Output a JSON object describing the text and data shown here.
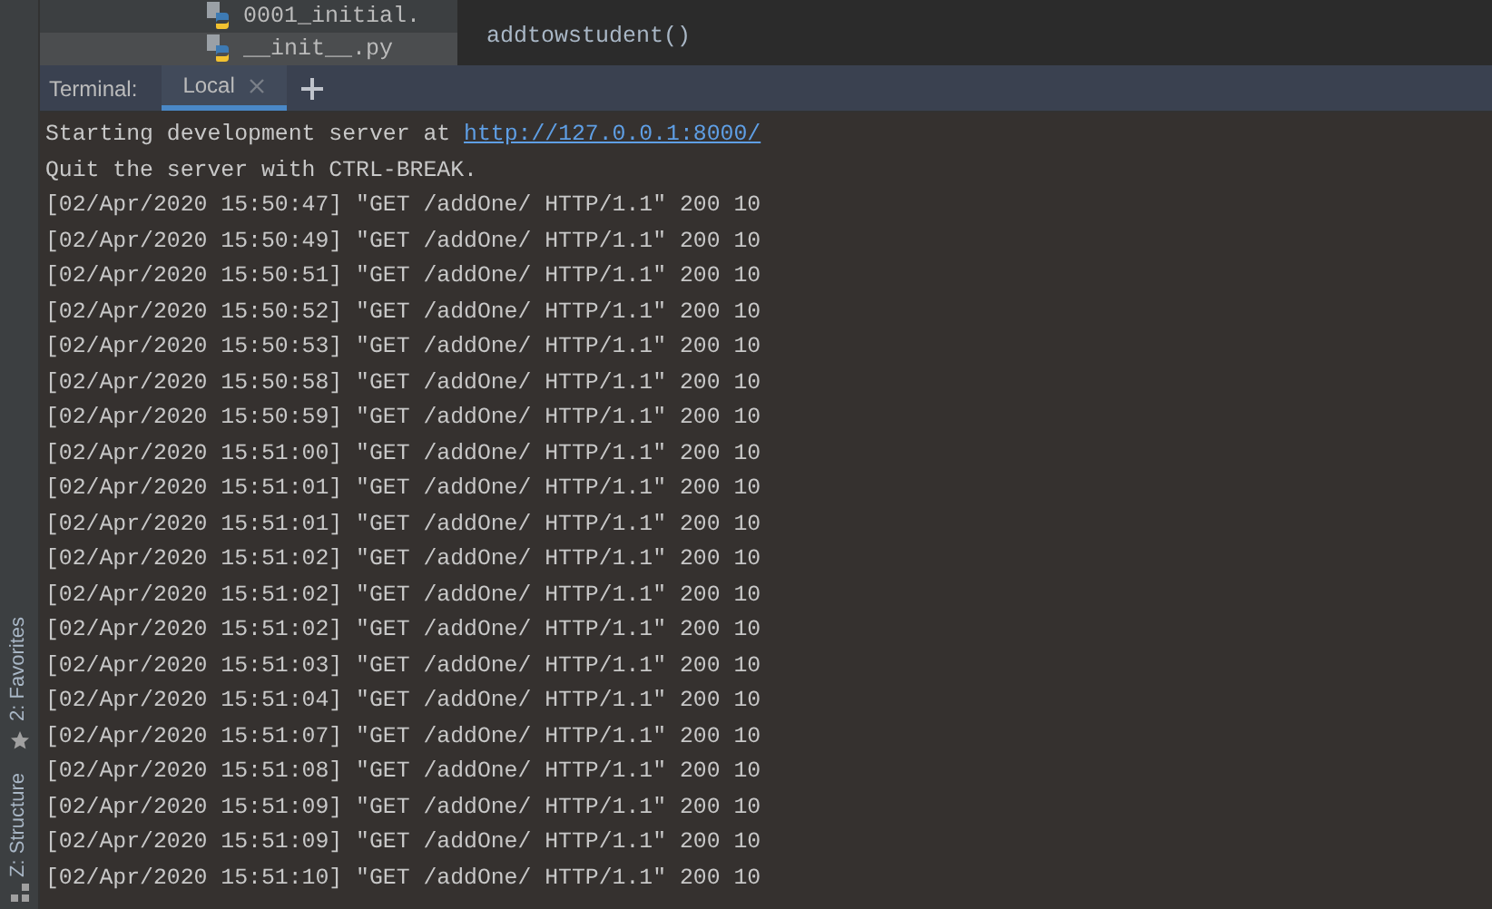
{
  "side_tool_windows": [
    {
      "label": "2: Favorites"
    },
    {
      "label": "Z: Structure"
    }
  ],
  "project_tree": [
    {
      "label": "0001_initial.",
      "selected": false
    },
    {
      "label": "__init__.py",
      "selected": true
    }
  ],
  "editor": {
    "code_line": "addtowstudent()"
  },
  "terminal": {
    "title": "Terminal:",
    "tabs": [
      {
        "label": "Local",
        "selected": true
      }
    ],
    "intro": {
      "text": "Starting development server at",
      "link": "http://127.0.0.1:8000/"
    },
    "lines": [
      "Quit the server with CTRL-BREAK.",
      "[02/Apr/2020 15:50:47] \"GET /addOne/ HTTP/1.1\" 200 10",
      "[02/Apr/2020 15:50:49] \"GET /addOne/ HTTP/1.1\" 200 10",
      "[02/Apr/2020 15:50:51] \"GET /addOne/ HTTP/1.1\" 200 10",
      "[02/Apr/2020 15:50:52] \"GET /addOne/ HTTP/1.1\" 200 10",
      "[02/Apr/2020 15:50:53] \"GET /addOne/ HTTP/1.1\" 200 10",
      "[02/Apr/2020 15:50:58] \"GET /addOne/ HTTP/1.1\" 200 10",
      "[02/Apr/2020 15:50:59] \"GET /addOne/ HTTP/1.1\" 200 10",
      "[02/Apr/2020 15:51:00] \"GET /addOne/ HTTP/1.1\" 200 10",
      "[02/Apr/2020 15:51:01] \"GET /addOne/ HTTP/1.1\" 200 10",
      "[02/Apr/2020 15:51:01] \"GET /addOne/ HTTP/1.1\" 200 10",
      "[02/Apr/2020 15:51:02] \"GET /addOne/ HTTP/1.1\" 200 10",
      "[02/Apr/2020 15:51:02] \"GET /addOne/ HTTP/1.1\" 200 10",
      "[02/Apr/2020 15:51:02] \"GET /addOne/ HTTP/1.1\" 200 10",
      "[02/Apr/2020 15:51:03] \"GET /addOne/ HTTP/1.1\" 200 10",
      "[02/Apr/2020 15:51:04] \"GET /addOne/ HTTP/1.1\" 200 10",
      "[02/Apr/2020 15:51:07] \"GET /addOne/ HTTP/1.1\" 200 10",
      "[02/Apr/2020 15:51:08] \"GET /addOne/ HTTP/1.1\" 200 10",
      "[02/Apr/2020 15:51:09] \"GET /addOne/ HTTP/1.1\" 200 10",
      "[02/Apr/2020 15:51:09] \"GET /addOne/ HTTP/1.1\" 200 10",
      "[02/Apr/2020 15:51:10] \"GET /addOne/ HTTP/1.1\" 200 10"
    ]
  }
}
